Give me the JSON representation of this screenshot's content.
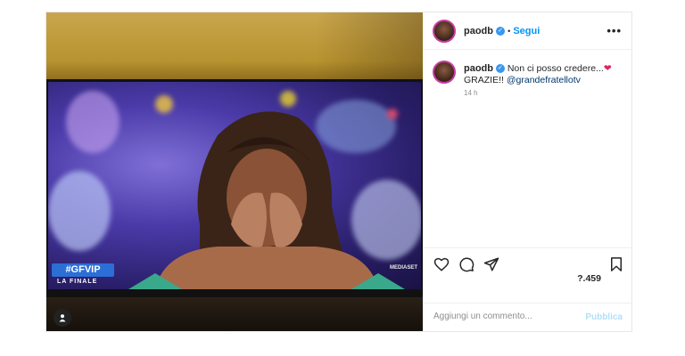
{
  "header": {
    "username": "paodb",
    "separator": "•",
    "follow_label": "Segui",
    "more_icon": "more-dots-icon"
  },
  "caption": {
    "username": "paodb",
    "line1": "Non ci posso credere...",
    "heart": "❤",
    "line2": "GRAZIE!!",
    "mention": "@grandefratellotv",
    "time": "14 h"
  },
  "media": {
    "overlay_logo": "#GFVIP",
    "overlay_sub": "LA FINALE",
    "broadcaster": "MEDIASET"
  },
  "actions": {
    "likes": "?.459",
    "icons": [
      "heart-icon",
      "comment-icon",
      "share-icon",
      "bookmark-icon"
    ]
  },
  "comment": {
    "placeholder": "Aggiungi un commento...",
    "post_label": "Pubblica"
  },
  "colors": {
    "accent": "#0095f6",
    "verified": "#3897f0",
    "post_disabled": "#b2dffc",
    "heart": "#e0245e"
  }
}
